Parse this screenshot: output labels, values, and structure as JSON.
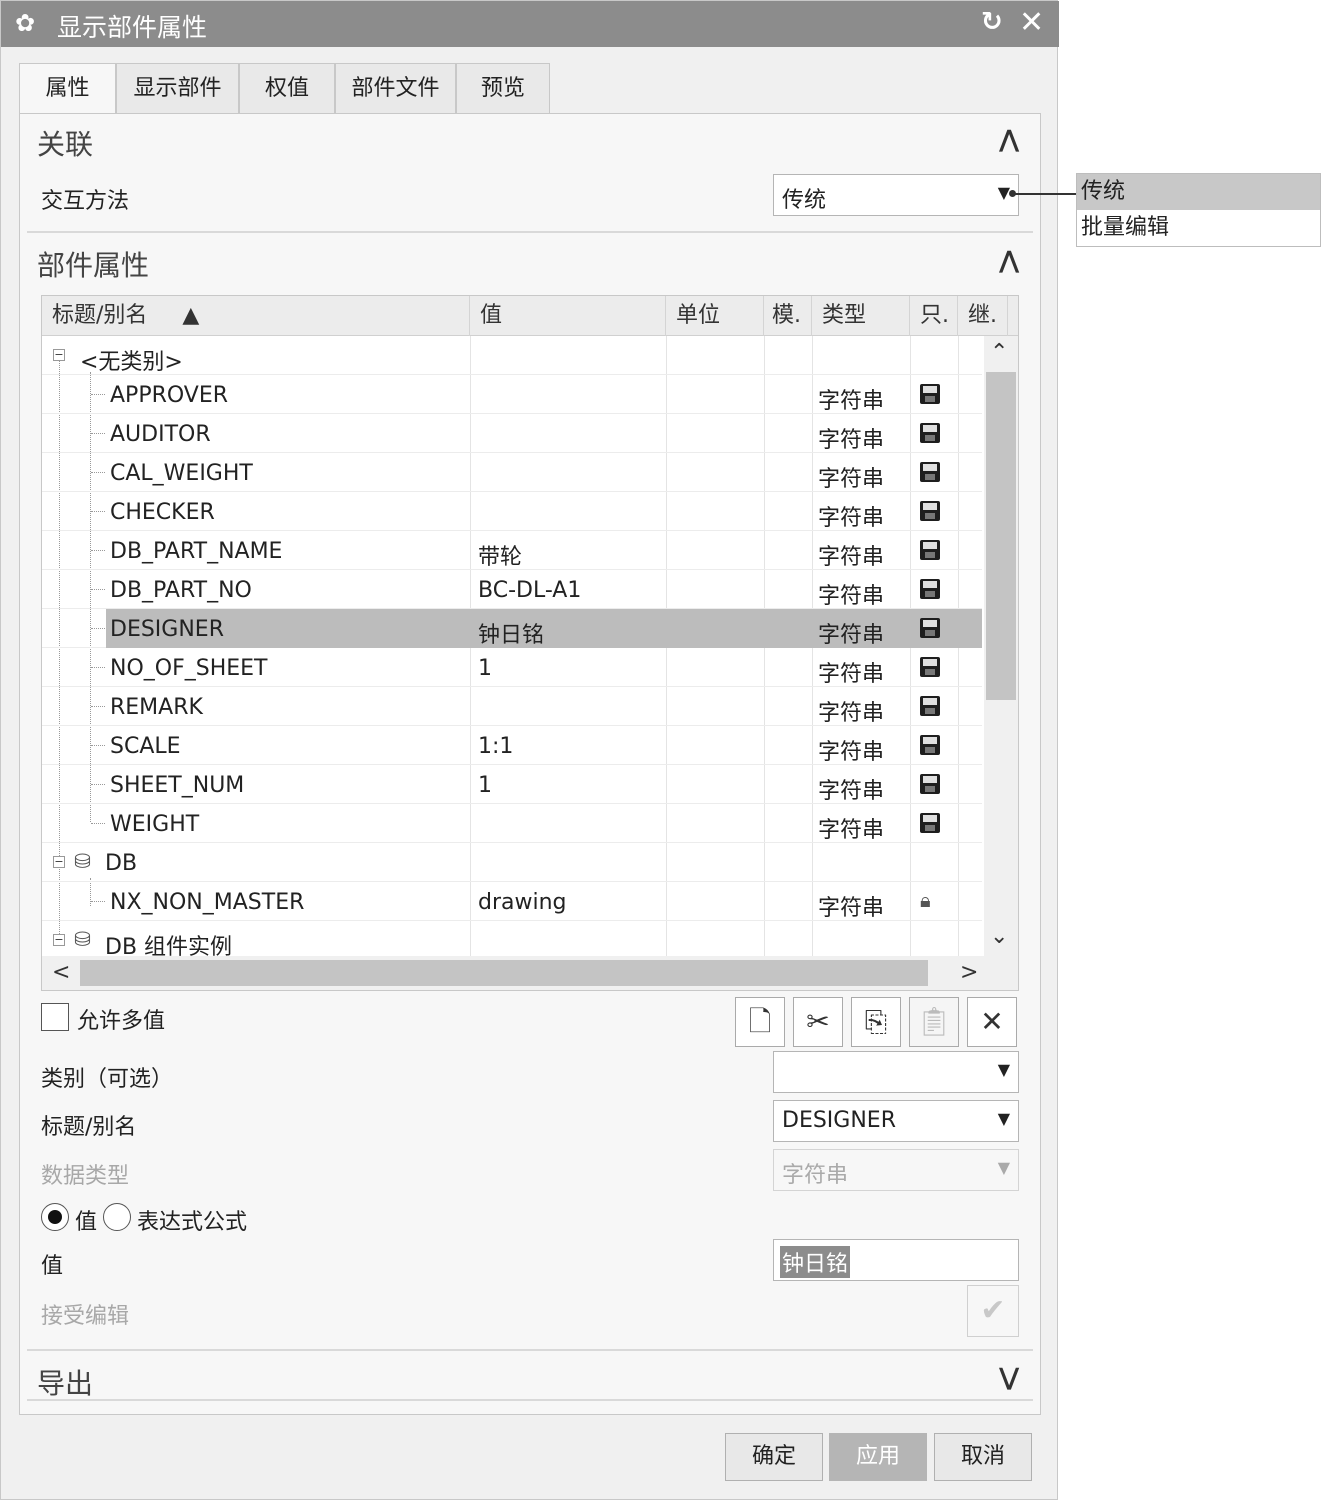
{
  "window": {
    "title": "显示部件属性",
    "reset_icon": "reset-icon",
    "close_icon": "close-icon"
  },
  "tabs": [
    {
      "label": "属性",
      "active": true
    },
    {
      "label": "显示部件"
    },
    {
      "label": "权值"
    },
    {
      "label": "部件文件"
    },
    {
      "label": "预览"
    }
  ],
  "association": {
    "section_title": "关联",
    "interaction_label": "交互方法",
    "interaction_value": "传统",
    "popup_options": [
      "传统",
      "批量编辑"
    ]
  },
  "part_attributes": {
    "section_title": "部件属性",
    "columns": [
      "标题/别名",
      "值",
      "单位",
      "模.",
      "类型",
      "只.",
      "继."
    ],
    "sort_indicator": "▲",
    "groups": [
      {
        "name": "<无类别>"
      },
      {
        "name": "DB"
      },
      {
        "name": "DB 组件实例"
      }
    ],
    "rows": [
      {
        "title": "APPROVER",
        "value": "",
        "type": "字符串",
        "icon": "save-icon"
      },
      {
        "title": "AUDITOR",
        "value": "",
        "type": "字符串",
        "icon": "save-icon"
      },
      {
        "title": "CAL_WEIGHT",
        "value": "",
        "type": "字符串",
        "icon": "save-icon"
      },
      {
        "title": "CHECKER",
        "value": "",
        "type": "字符串",
        "icon": "save-icon"
      },
      {
        "title": "DB_PART_NAME",
        "value": "带轮",
        "type": "字符串",
        "icon": "save-icon"
      },
      {
        "title": "DB_PART_NO",
        "value": "BC-DL-A1",
        "type": "字符串",
        "icon": "save-icon"
      },
      {
        "title": "DESIGNER",
        "value": "钟日铭",
        "type": "字符串",
        "icon": "save-icon",
        "selected": true
      },
      {
        "title": "NO_OF_SHEET",
        "value": "1",
        "type": "字符串",
        "icon": "save-icon"
      },
      {
        "title": "REMARK",
        "value": "",
        "type": "字符串",
        "icon": "save-icon"
      },
      {
        "title": "SCALE",
        "value": "1:1",
        "type": "字符串",
        "icon": "save-icon"
      },
      {
        "title": "SHEET_NUM",
        "value": "1",
        "type": "字符串",
        "icon": "save-icon"
      },
      {
        "title": "WEIGHT",
        "value": "",
        "type": "字符串",
        "icon": "save-icon"
      },
      {
        "title": "NX_NON_MASTER",
        "value": "drawing",
        "type": "字符串",
        "icon": "lock-icon"
      }
    ]
  },
  "form": {
    "allow_multi_label": "允许多值",
    "category_label": "类别（可选）",
    "category_value": "",
    "title_label": "标题/别名",
    "title_value": "DESIGNER",
    "datatype_label": "数据类型",
    "datatype_value": "字符串",
    "radio_value_label": "值",
    "radio_expression_label": "表达式公式",
    "value_label": "值",
    "value_value": "钟日铭",
    "accept_label": "接受编辑"
  },
  "export": {
    "section_title": "导出"
  },
  "buttons": {
    "ok": "确定",
    "apply": "应用",
    "cancel": "取消"
  }
}
